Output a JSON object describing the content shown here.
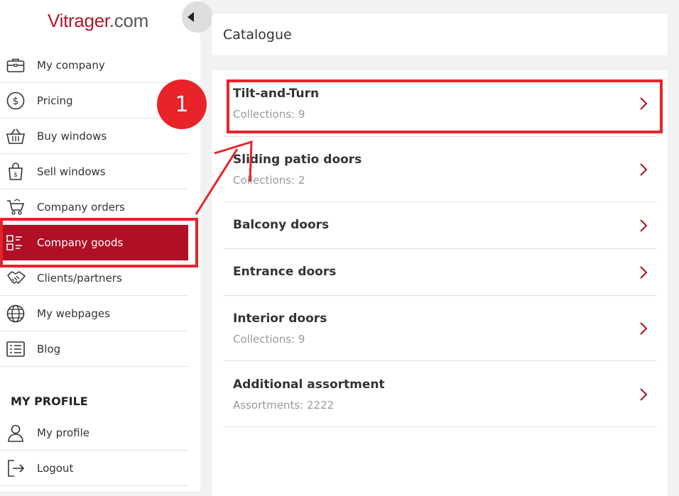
{
  "logo": {
    "part1": "Vitrager",
    "part2": ".com"
  },
  "sidebar": {
    "items": [
      {
        "label": "My company",
        "icon": "briefcase-icon"
      },
      {
        "label": "Pricing",
        "icon": "dollar-icon"
      },
      {
        "label": "Buy windows",
        "icon": "basket-icon"
      },
      {
        "label": "Sell windows",
        "icon": "shopping-bag-icon"
      },
      {
        "label": "Company orders",
        "icon": "cart-icon"
      },
      {
        "label": "Company goods",
        "icon": "goods-list-icon",
        "active": true
      },
      {
        "label": "Clients/partners",
        "icon": "handshake-icon"
      },
      {
        "label": "My webpages",
        "icon": "globe-icon"
      },
      {
        "label": "Blog",
        "icon": "blog-icon"
      }
    ],
    "section_title": "MY PROFILE",
    "profile_items": [
      {
        "label": "My profile",
        "icon": "user-icon"
      },
      {
        "label": "Logout",
        "icon": "logout-icon"
      }
    ]
  },
  "main": {
    "title": "Catalogue",
    "rows": [
      {
        "title": "Tilt-and-Turn",
        "sub": "Collections: 9"
      },
      {
        "title": "Sliding patio doors",
        "sub": "Collections: 2"
      },
      {
        "title": "Balcony doors",
        "sub": ""
      },
      {
        "title": "Entrance doors",
        "sub": ""
      },
      {
        "title": "Interior doors",
        "sub": "Collections: 9"
      },
      {
        "title": "Additional assortment",
        "sub": "Assortments: 2222"
      }
    ]
  },
  "annotation": {
    "step": "1",
    "color": "#e8232a"
  },
  "colors": {
    "brand": "#b00f25",
    "accent": "#b2182b"
  }
}
